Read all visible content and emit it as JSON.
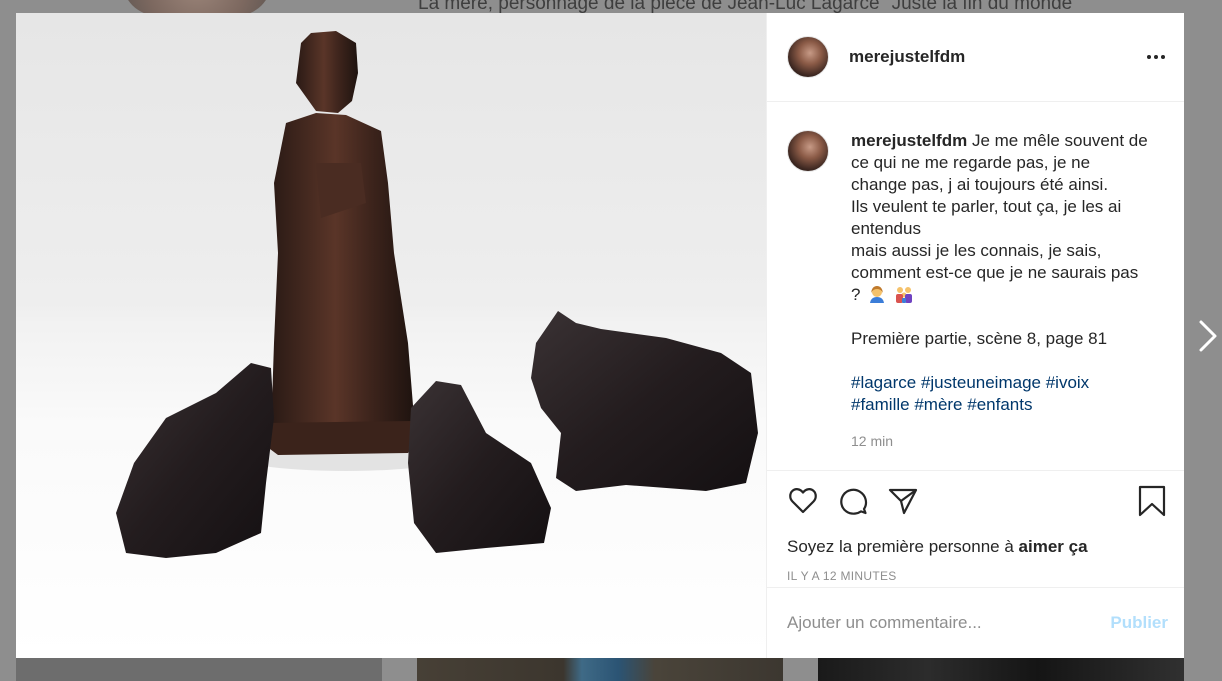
{
  "background": {
    "title_text": "La mère, personnage de la pièce de Jean-Luc Lagarce \"Juste la fin du monde\""
  },
  "post": {
    "username": "merejustelfdm",
    "more_options_icon": "ellipsis-icon",
    "caption": {
      "username": "merejustelfdm",
      "lines": [
        "Je me mêle souvent de",
        "ce qui ne me regarde pas, je ne",
        "change pas, j ai toujours été ainsi.",
        "Ils veulent te parler, tout ça, je les ai",
        "entendus",
        "mais aussi je les connais, je sais,",
        "comment est-ce que je ne saurais pas",
        "?"
      ],
      "reference": "Première partie, scène 8, page 81",
      "hashtags_line1": [
        "#lagarce",
        "#justeuneimage",
        "#ivoix"
      ],
      "hashtags_line2": [
        "#famille",
        "#mère",
        "#enfants"
      ],
      "time": "12 min"
    },
    "actions": {
      "like_icon": "heart-icon",
      "comment_icon": "comment-icon",
      "share_icon": "paper-plane-icon",
      "save_icon": "bookmark-icon"
    },
    "likes_prefix": "Soyez la première personne à",
    "likes_link": "aimer ça",
    "posted_ago": "IL Y A 12 MINUTES",
    "comment_placeholder": "Ajouter un commentaire...",
    "publish_label": "Publier"
  },
  "colors": {
    "link": "#00376b",
    "publish_disabled": "#b2dffc",
    "muted": "#8e8e8e",
    "text": "#262626"
  }
}
